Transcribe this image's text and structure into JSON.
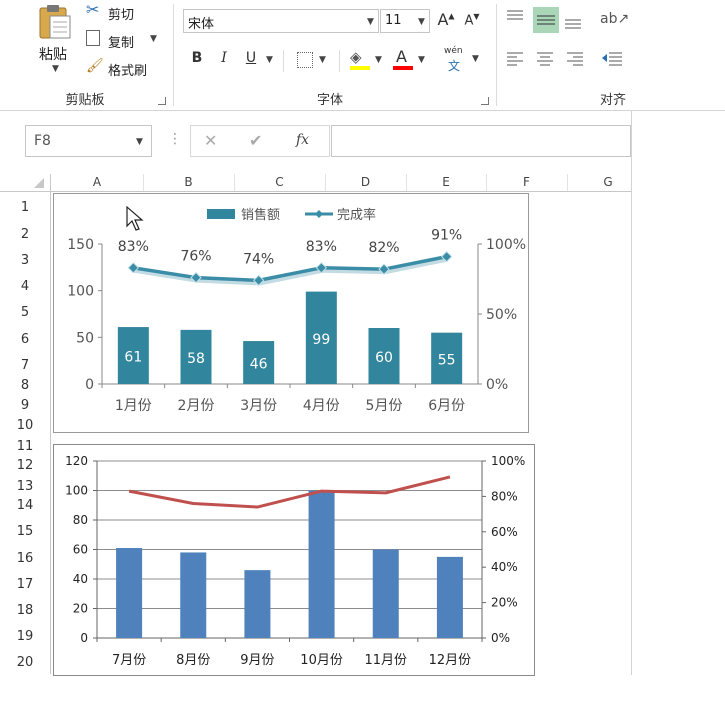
{
  "ribbon": {
    "clipboard": {
      "paste_label": "粘贴",
      "cut_label": "剪切",
      "copy_label": "复制",
      "format_painter_label": "格式刷",
      "group_label": "剪贴板"
    },
    "font": {
      "font_name": "宋体",
      "font_size": "11",
      "group_label": "字体",
      "bold": "B",
      "italic": "I",
      "underline": "U",
      "grow": "A",
      "shrink": "A",
      "font_color_letter": "A",
      "phonetic_top": "wén",
      "phonetic_bottom": "文"
    },
    "alignment": {
      "group_label": "对齐"
    }
  },
  "formula_bar": {
    "name_box": "F8",
    "fx": "fx"
  },
  "columns": [
    "A",
    "B",
    "C",
    "D",
    "E",
    "F",
    "G"
  ],
  "rows": [
    "1",
    "2",
    "3",
    "4",
    "5",
    "6",
    "7",
    "8",
    "9",
    "10",
    "11",
    "12",
    "13",
    "14",
    "15",
    "16",
    "17",
    "18",
    "19",
    "20"
  ],
  "colors": {
    "bar1": "#31859c",
    "line1": "#3b8ca6",
    "bar2": "#4f81bd",
    "line2": "#c0504d",
    "font_highlight": "#ffff00",
    "font_color": "#ff0000"
  },
  "chart_data": [
    {
      "type": "bar",
      "categories": [
        "1月份",
        "2月份",
        "3月份",
        "4月份",
        "5月份",
        "6月份"
      ],
      "series": [
        {
          "name": "销售额",
          "type": "bar",
          "axis": "left",
          "values": [
            61,
            58,
            46,
            99,
            60,
            55
          ]
        },
        {
          "name": "完成率",
          "type": "line",
          "axis": "right",
          "values": [
            83,
            76,
            74,
            83,
            82,
            91
          ]
        }
      ],
      "bar_labels": [
        "61",
        "58",
        "46",
        "99",
        "60",
        "55"
      ],
      "line_labels": [
        "83%",
        "76%",
        "74%",
        "83%",
        "82%",
        "91%"
      ],
      "ylim": [
        0,
        150
      ],
      "y_ticks": [
        "0",
        "50",
        "100",
        "150"
      ],
      "y2lim": [
        0,
        100
      ],
      "y2_ticks": [
        "0%",
        "50%",
        "100%"
      ],
      "legend": "top",
      "grid": false
    },
    {
      "type": "bar",
      "categories": [
        "7月份",
        "8月份",
        "9月份",
        "10月份",
        "11月份",
        "12月份"
      ],
      "series": [
        {
          "type": "bar",
          "axis": "left",
          "values": [
            61,
            58,
            46,
            100,
            60,
            55
          ]
        },
        {
          "type": "line",
          "axis": "right",
          "values": [
            83,
            76,
            74,
            83,
            82,
            91
          ]
        }
      ],
      "ylim": [
        0,
        120
      ],
      "y_ticks": [
        "0",
        "20",
        "40",
        "60",
        "80",
        "100",
        "120"
      ],
      "y2lim": [
        0,
        100
      ],
      "y2_ticks": [
        "0%",
        "20%",
        "40%",
        "60%",
        "80%",
        "100%"
      ],
      "grid": true
    }
  ]
}
